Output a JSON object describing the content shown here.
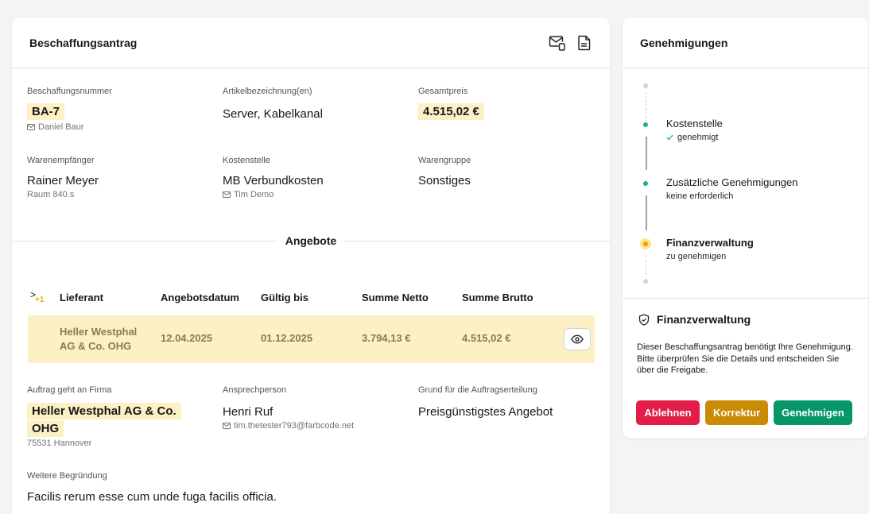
{
  "main": {
    "title": "Beschaffungsantrag",
    "icons": [
      "mail-attachment-icon",
      "document-icon"
    ],
    "fields": {
      "number": {
        "label": "Beschaffungsnummer",
        "value": "BA-7",
        "sub": "Daniel Baur"
      },
      "articles": {
        "label": "Artikelbezeichnung(en)",
        "value": "Server, Kabelkanal"
      },
      "total": {
        "label": "Gesamtpreis",
        "value": "4.515,02 €"
      },
      "recipient": {
        "label": "Warenempfänger",
        "value": "Rainer Meyer",
        "sub": "Raum 840.s"
      },
      "costcenter": {
        "label": "Kostenstelle",
        "value": "MB Verbundkosten",
        "sub": "Tim Demo"
      },
      "group": {
        "label": "Warengruppe",
        "value": "Sonstiges"
      }
    },
    "offers_heading": "Angebote",
    "table": {
      "expand_glyph": ">",
      "extra_count": "+1",
      "columns": [
        "Lieferant",
        "Angebotsdatum",
        "Gültig bis",
        "Summe Netto",
        "Summe Brutto"
      ],
      "rows": [
        {
          "supplier": "Heller Westphal AG & Co. OHG",
          "date": "12.04.2025",
          "valid": "01.12.2025",
          "net": "3.794,13 €",
          "gross": "4.515,02 €"
        }
      ]
    },
    "order": {
      "company": {
        "label": "Auftrag geht an Firma",
        "value": "Heller Westphal AG & Co. OHG",
        "sub": "75531 Hannover"
      },
      "contact": {
        "label": "Ansprechperson",
        "value": "Henri Ruf",
        "sub": "tim.thetester793@farbcode.net"
      },
      "reason": {
        "label": "Grund für die Auftragserteilung",
        "value": "Preisgünstigstes Angebot"
      },
      "justification": {
        "label": "Weitere Begründung",
        "value": "Facilis rerum esse cum unde fuga facilis officia."
      }
    }
  },
  "sidebar": {
    "title": "Genehmigungen",
    "steps": [
      {
        "title": "Kostenstelle",
        "status": "genehmigt",
        "state": "done"
      },
      {
        "title": "Zusätzliche Genehmigungen",
        "status": "keine erforderlich",
        "state": "done"
      },
      {
        "title": "Finanzverwaltung",
        "status": "zu genehmigen",
        "state": "pending"
      }
    ],
    "finance": {
      "title": "Finanzverwaltung",
      "description": "Dieser Beschaffungsantrag benötigt Ihre Genehmigung. Bitte überprüfen Sie die Details und entscheiden Sie über die Freigabe.",
      "buttons": {
        "reject": "Ablehnen",
        "correct": "Korrektur",
        "approve": "Genehmigen"
      }
    }
  },
  "colors": {
    "highlight": "#fdf0c4",
    "done": "#10b981",
    "pending": "#f59e0b",
    "reject": "#e11d48",
    "correct": "#ca8a04",
    "approve": "#059669"
  }
}
